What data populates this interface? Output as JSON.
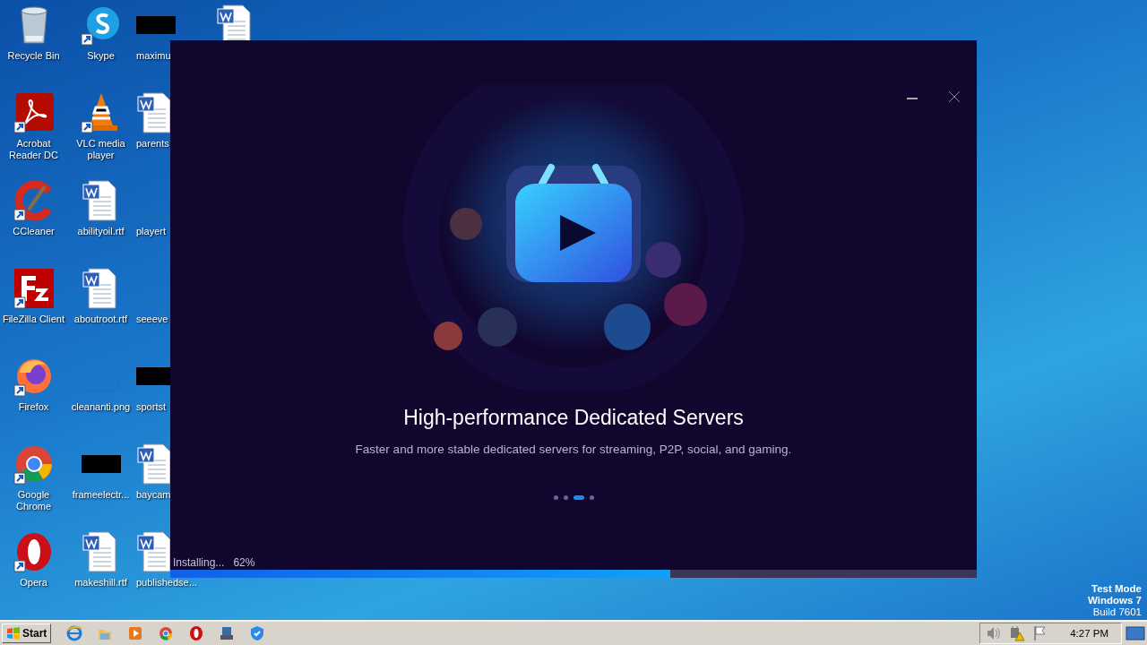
{
  "desktop": {
    "columns": [
      [
        {
          "label": "Recycle Bin",
          "kind": "recycle"
        },
        {
          "label": "Acrobat Reader DC",
          "kind": "acrobat"
        },
        {
          "label": "CCleaner",
          "kind": "ccleaner"
        },
        {
          "label": "FileZilla Client",
          "kind": "filezilla"
        },
        {
          "label": "Firefox",
          "kind": "firefox"
        },
        {
          "label": "Google Chrome",
          "kind": "chrome"
        },
        {
          "label": "Opera",
          "kind": "opera"
        }
      ],
      [
        {
          "label": "Skype",
          "kind": "skype"
        },
        {
          "label": "VLC media player",
          "kind": "vlc"
        },
        {
          "label": "abilityoil.rtf",
          "kind": "word"
        },
        {
          "label": "aboutroot.rtf",
          "kind": "word"
        },
        {
          "label": "cleananti.png",
          "kind": "blank"
        },
        {
          "label": "frameelectr...",
          "kind": "blackout"
        },
        {
          "label": "makeshill.rtf",
          "kind": "word"
        }
      ],
      [
        {
          "label": "maximu",
          "kind": "blackout"
        },
        {
          "label": "parents",
          "kind": "word"
        },
        {
          "label": "playert",
          "kind": "blank"
        },
        {
          "label": "seeeve",
          "kind": "blank"
        },
        {
          "label": "sportst",
          "kind": "blackout"
        },
        {
          "label": "baycam",
          "kind": "word"
        },
        {
          "label": "publishedse...",
          "kind": "word"
        }
      ],
      [
        {
          "kind": "word"
        }
      ]
    ],
    "os_notice": [
      "Test Mode",
      "Windows 7",
      "Build 7601"
    ]
  },
  "installer": {
    "title": "High-performance Dedicated Servers",
    "subtitle": "Faster and more stable dedicated servers for streaming, P2P, social, and gaming.",
    "slides": [
      {
        "selected": false
      },
      {
        "selected": false
      },
      {
        "selected": true
      },
      {
        "selected": false
      }
    ],
    "status": "Installing...",
    "percent": "62%",
    "level": 0.62
  },
  "taskbar": {
    "start": "Start",
    "apps": [
      {
        "kind": "ie"
      },
      {
        "kind": "folder"
      },
      {
        "kind": "media"
      },
      {
        "kind": "chrome"
      },
      {
        "kind": "opera"
      },
      {
        "kind": "app"
      },
      {
        "kind": "shield"
      }
    ],
    "tray": [
      {
        "kind": "volume"
      },
      {
        "kind": "network"
      },
      {
        "kind": "flag"
      }
    ],
    "clock": "4:27 PM"
  }
}
